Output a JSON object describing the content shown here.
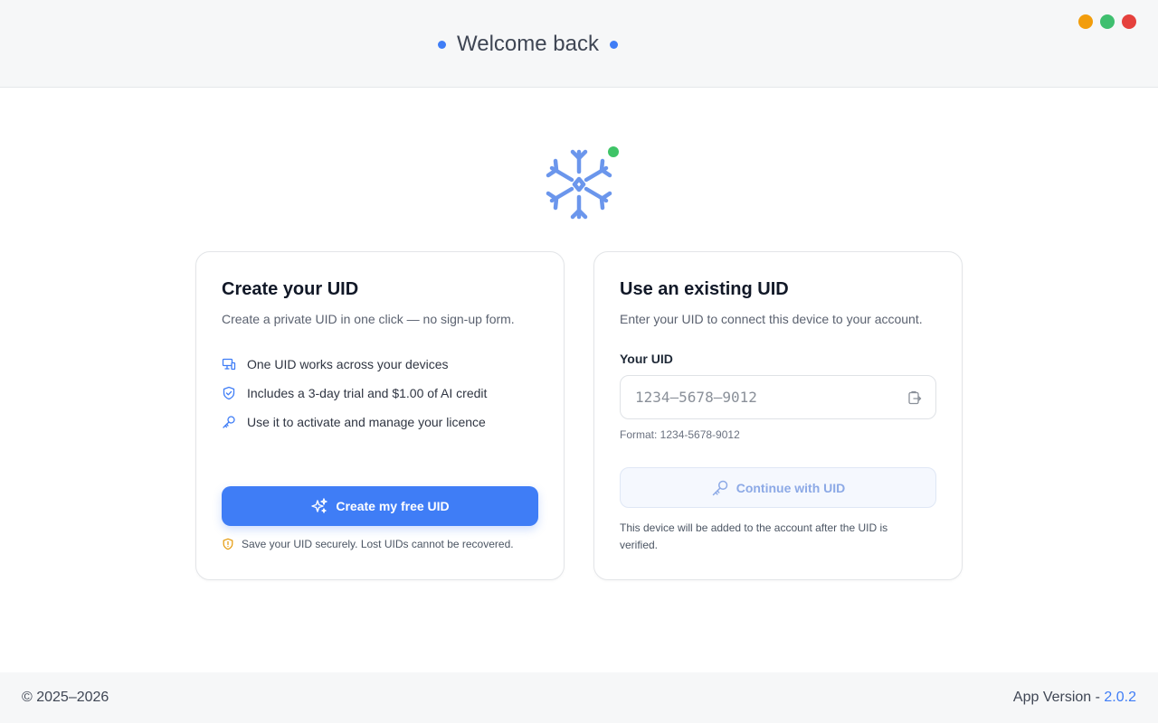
{
  "window": {
    "title": "Welcome back",
    "controls": [
      {
        "name": "minimize",
        "color": "#f29d0c"
      },
      {
        "name": "maximize",
        "color": "#3fbf6f"
      },
      {
        "name": "close",
        "color": "#e5413d"
      }
    ]
  },
  "brand": {
    "icon": "snowflake-logo-icon",
    "status": "online",
    "status_color": "#3fc467"
  },
  "create_card": {
    "title": "Create your UID",
    "subtitle": "Create a private UID in one click — no sign-up form.",
    "features": [
      {
        "icon": "devices-icon",
        "text": "One UID works across your devices"
      },
      {
        "icon": "shield-check-icon",
        "text": "Includes a 3-day trial and $1.00 of AI credit"
      },
      {
        "icon": "key-icon",
        "text": "Use it to activate and manage your licence"
      }
    ],
    "button_label": "Create my free UID",
    "button_icon": "sparkles-icon",
    "warning": "Save your UID securely. Lost UIDs cannot be recovered.",
    "warning_icon": "shield-alert-icon"
  },
  "existing_card": {
    "title": "Use an existing UID",
    "subtitle": "Enter your UID to connect this device to your account.",
    "field_label": "Your UID",
    "input_value": "",
    "input_placeholder": "1234–5678–9012",
    "paste_icon": "paste-icon",
    "format_hint": "Format: 1234-5678-9012",
    "button_label": "Continue with UID",
    "button_icon": "key-icon",
    "note": "This device will be added to the account after the UID is verified."
  },
  "footer": {
    "copyright": "© 2025–2026",
    "version_label": "App Version - ",
    "version": "2.0.2"
  },
  "colors": {
    "accent": "#3f7df6",
    "warning": "#e59a0b"
  }
}
